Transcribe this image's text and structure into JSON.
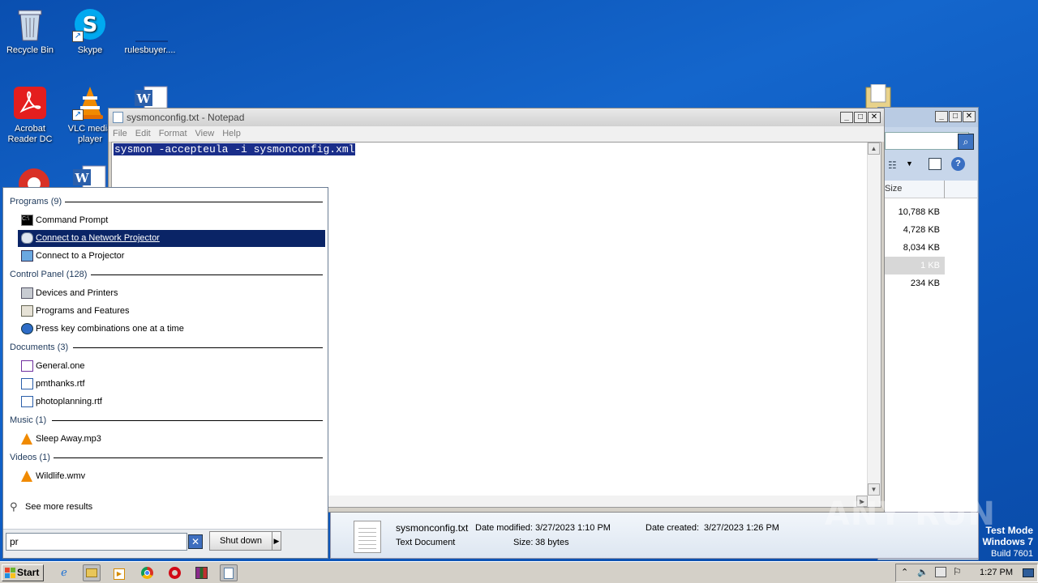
{
  "desktop": {
    "icons": [
      {
        "label": "Recycle Bin"
      },
      {
        "label": "Skype"
      },
      {
        "label": "rulesbuyer...."
      },
      {
        "label": "Acrobat Reader DC"
      },
      {
        "label": "VLC media player"
      }
    ]
  },
  "notepad": {
    "title": "sysmonconfig.txt - Notepad",
    "menu": [
      "File",
      "Edit",
      "Format",
      "View",
      "Help"
    ],
    "content": "sysmon -accepteula -i sysmonconfig.xml"
  },
  "explorer": {
    "column_header": "Size",
    "sizes": [
      "10,788 KB",
      "4,728 KB",
      "8,034 KB",
      "1 KB",
      "234 KB"
    ]
  },
  "details_pane": {
    "filename": "sysmonconfig.txt",
    "filetype": "Text Document",
    "date_modified_label": "Date modified:",
    "date_modified": "3/27/2023 1:10 PM",
    "size_label": "Size:",
    "size": "38 bytes",
    "date_created_label": "Date created:",
    "date_created": "3/27/2023 1:26 PM"
  },
  "start_menu": {
    "groups": [
      {
        "title": "Programs (9)",
        "items": [
          "Command Prompt",
          "Connect to a Network Projector",
          "Connect to a Projector"
        ]
      },
      {
        "title": "Control Panel (128)",
        "items": [
          "Devices and Printers",
          "Programs and Features",
          "Press key combinations one at a time"
        ]
      },
      {
        "title": "Documents (3)",
        "items": [
          "General.one",
          "pmthanks.rtf",
          "photoplanning.rtf"
        ]
      },
      {
        "title": "Music (1)",
        "items": [
          "Sleep Away.mp3"
        ]
      },
      {
        "title": "Videos (1)",
        "items": [
          "Wildlife.wmv"
        ]
      }
    ],
    "see_more": "See more results",
    "search_value": "pr",
    "shutdown_label": "Shut down"
  },
  "taskbar": {
    "start_label": "Start",
    "clock": "1:27 PM"
  },
  "watermark": {
    "text": "ANY RUN",
    "line1": "Test Mode",
    "line2": "Windows 7",
    "line3": "Build 7601"
  },
  "colors": {
    "desktop_bg": "#1466cc",
    "highlight": "#0a2466",
    "selection": "#1a2e8a"
  }
}
